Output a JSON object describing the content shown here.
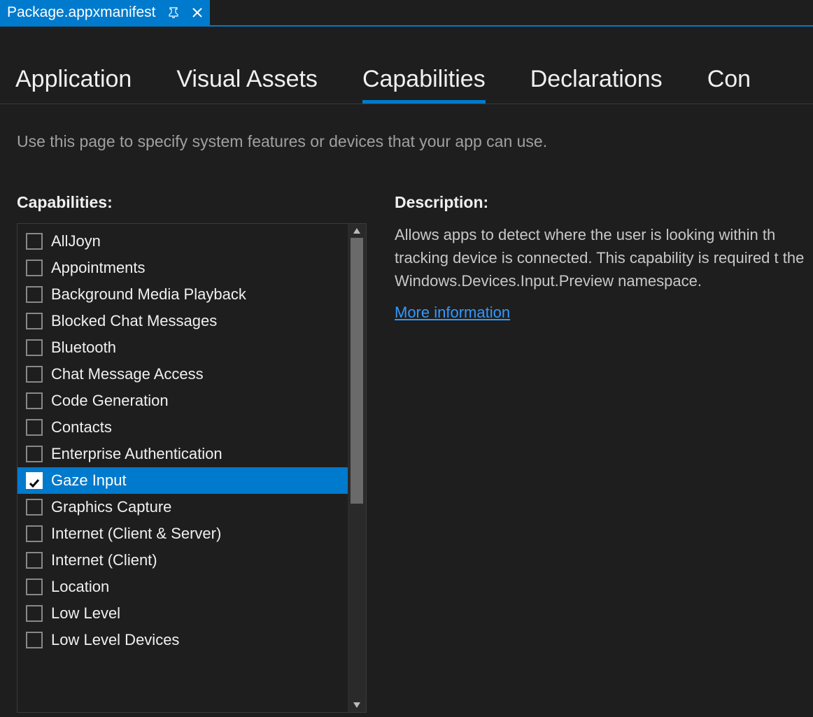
{
  "doc_tab": {
    "title": "Package.appxmanifest"
  },
  "nav_tabs": [
    {
      "label": "Application",
      "active": false
    },
    {
      "label": "Visual Assets",
      "active": false
    },
    {
      "label": "Capabilities",
      "active": true
    },
    {
      "label": "Declarations",
      "active": false
    },
    {
      "label": "Con",
      "active": false
    }
  ],
  "intro_text": "Use this page to specify system features or devices that your app can use.",
  "capabilities_header": "Capabilities:",
  "description_header": "Description:",
  "capabilities": [
    {
      "label": "AllJoyn",
      "checked": false,
      "selected": false
    },
    {
      "label": "Appointments",
      "checked": false,
      "selected": false
    },
    {
      "label": "Background Media Playback",
      "checked": false,
      "selected": false
    },
    {
      "label": "Blocked Chat Messages",
      "checked": false,
      "selected": false
    },
    {
      "label": "Bluetooth",
      "checked": false,
      "selected": false
    },
    {
      "label": "Chat Message Access",
      "checked": false,
      "selected": false
    },
    {
      "label": "Code Generation",
      "checked": false,
      "selected": false
    },
    {
      "label": "Contacts",
      "checked": false,
      "selected": false
    },
    {
      "label": "Enterprise Authentication",
      "checked": false,
      "selected": false
    },
    {
      "label": "Gaze Input",
      "checked": true,
      "selected": true
    },
    {
      "label": "Graphics Capture",
      "checked": false,
      "selected": false
    },
    {
      "label": "Internet (Client & Server)",
      "checked": false,
      "selected": false
    },
    {
      "label": "Internet (Client)",
      "checked": false,
      "selected": false
    },
    {
      "label": "Location",
      "checked": false,
      "selected": false
    },
    {
      "label": "Low Level",
      "checked": false,
      "selected": false
    },
    {
      "label": "Low Level Devices",
      "checked": false,
      "selected": false
    }
  ],
  "description_text": "Allows apps to detect where the user is looking within th tracking device is connected. This capability is required t the Windows.Devices.Input.Preview namespace.",
  "more_info_label": "More information"
}
